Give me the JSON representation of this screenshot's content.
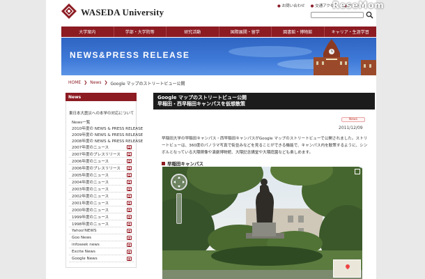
{
  "site": {
    "logo_text": "WASEDA University",
    "watermark": "ReseMom"
  },
  "top_links": [
    "お問い合わせ",
    "交通アクセス",
    "サイト"
  ],
  "search": {
    "placeholder": ""
  },
  "nav": [
    "大学案内",
    "学部・大学院等",
    "研究活動",
    "国際展開・留学",
    "図書館・博物館",
    "キャリア・生涯学習"
  ],
  "banner": {
    "title": "NEWS&PRESS RELEASE"
  },
  "breadcrumb": {
    "home": "HOME",
    "news": "News",
    "current": "Google マップのストリートビュー公開"
  },
  "sidebar": {
    "heading": "News",
    "notice": "東日本大震災への本学の対応について",
    "items": [
      {
        "label": "News一覧",
        "icon": false,
        "plain": true
      },
      {
        "label": "2010年度の NEWS & PRESS RELEASE",
        "icon": false,
        "plain": true
      },
      {
        "label": "2009年度の NEWS & PRESS RELEASE",
        "icon": false,
        "plain": true
      },
      {
        "label": "2008年度の NEWS & PRESS RELEASE",
        "icon": false,
        "plain": true
      },
      {
        "label": "2007年度のニュース",
        "icon": true
      },
      {
        "label": "2007年度のプレスリリース",
        "icon": true
      },
      {
        "label": "2006年度のニュース",
        "icon": true
      },
      {
        "label": "2006年度のプレスリリース",
        "icon": true
      },
      {
        "label": "2005年度のニュース",
        "icon": true
      },
      {
        "label": "2004年度のニュース",
        "icon": true
      },
      {
        "label": "2003年度のニュース",
        "icon": true
      },
      {
        "label": "2002年度のニュース",
        "icon": true
      },
      {
        "label": "2001年度のニュース",
        "icon": true
      },
      {
        "label": "2000年度のニュース",
        "icon": true
      },
      {
        "label": "1999年度のニュース",
        "icon": true
      },
      {
        "label": "1998年度のニュース",
        "icon": true
      },
      {
        "label": "Yahoo!NEWS",
        "icon": true
      },
      {
        "label": "Goo News",
        "icon": true
      },
      {
        "label": "infoseek news",
        "icon": true
      },
      {
        "label": "Excite News",
        "icon": true
      },
      {
        "label": "Google News",
        "icon": true
      }
    ]
  },
  "article": {
    "title_line1": "Google マップのストリートビュー公開",
    "title_line2": "早稲田・西早稲田キャンパスを仮想散策",
    "tag": "News",
    "date": "2011/12/09",
    "body": "早稲田大学の早稲田キャンパス・西早稲田キャンパスがGoogle マップのストリートビューで公開されました。ストリートビューは、360度のパノラマ写真で街並みなどを見ることができる機能で、キャンパス内を散策するように、シンボルとなっている大隈銅像や演劇博物館、大隈記念講堂や大隈庭園なども楽しめます。",
    "section_heading": "早稲田キャンパス"
  },
  "colors": {
    "brand": "#8c1b22",
    "banner": "#3f7ad8",
    "title_bar": "#1c1c1c"
  }
}
